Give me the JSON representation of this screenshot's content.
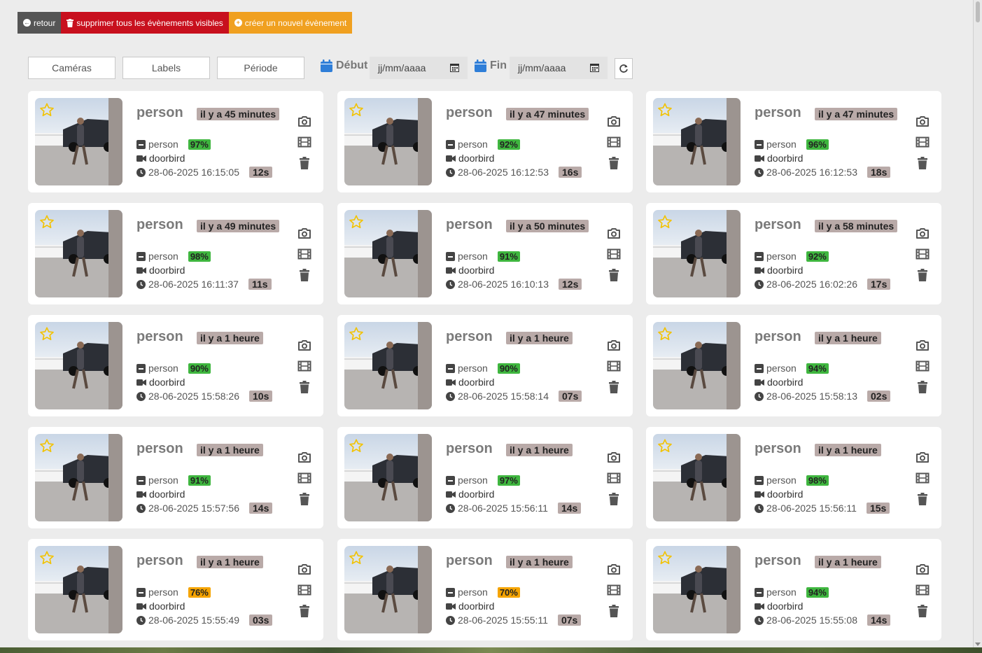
{
  "toolbar": {
    "back_label": "retour",
    "delete_all_label": "supprimer tous les évènements visibles",
    "new_event_label": "créer un nouvel évènement"
  },
  "filters": {
    "cameras_label": "Caméras",
    "labels_label": "Labels",
    "period_label": "Période",
    "start_label": "Début",
    "start_placeholder": "jj/mm/aaaa",
    "end_label": "Fin",
    "end_placeholder": "jj/mm/aaaa"
  },
  "colors": {
    "score_green": "#3fb63f",
    "score_orange": "#f5a400",
    "badge_bg": "#b9aaa8",
    "calendar_blue": "#2f7ed8"
  },
  "events": [
    {
      "label": "person",
      "ago": "il y a 45 minutes",
      "object": "person",
      "score": "97%",
      "score_level": "high",
      "camera": "doorbird",
      "datetime": "28-06-2025 16:15:05",
      "duration": "12s"
    },
    {
      "label": "person",
      "ago": "il y a 47 minutes",
      "object": "person",
      "score": "92%",
      "score_level": "high",
      "camera": "doorbird",
      "datetime": "28-06-2025 16:12:53",
      "duration": "16s"
    },
    {
      "label": "person",
      "ago": "il y a 47 minutes",
      "object": "person",
      "score": "96%",
      "score_level": "high",
      "camera": "doorbird",
      "datetime": "28-06-2025 16:12:53",
      "duration": "18s"
    },
    {
      "label": "person",
      "ago": "il y a 49 minutes",
      "object": "person",
      "score": "98%",
      "score_level": "high",
      "camera": "doorbird",
      "datetime": "28-06-2025 16:11:37",
      "duration": "11s"
    },
    {
      "label": "person",
      "ago": "il y a 50 minutes",
      "object": "person",
      "score": "91%",
      "score_level": "high",
      "camera": "doorbird",
      "datetime": "28-06-2025 16:10:13",
      "duration": "12s"
    },
    {
      "label": "person",
      "ago": "il y a 58 minutes",
      "object": "person",
      "score": "92%",
      "score_level": "high",
      "camera": "doorbird",
      "datetime": "28-06-2025 16:02:26",
      "duration": "17s"
    },
    {
      "label": "person",
      "ago": "il y a 1 heure",
      "object": "person",
      "score": "90%",
      "score_level": "high",
      "camera": "doorbird",
      "datetime": "28-06-2025 15:58:26",
      "duration": "10s"
    },
    {
      "label": "person",
      "ago": "il y a 1 heure",
      "object": "person",
      "score": "90%",
      "score_level": "high",
      "camera": "doorbird",
      "datetime": "28-06-2025 15:58:14",
      "duration": "07s"
    },
    {
      "label": "person",
      "ago": "il y a 1 heure",
      "object": "person",
      "score": "94%",
      "score_level": "high",
      "camera": "doorbird",
      "datetime": "28-06-2025 15:58:13",
      "duration": "02s"
    },
    {
      "label": "person",
      "ago": "il y a 1 heure",
      "object": "person",
      "score": "91%",
      "score_level": "high",
      "camera": "doorbird",
      "datetime": "28-06-2025 15:57:56",
      "duration": "14s"
    },
    {
      "label": "person",
      "ago": "il y a 1 heure",
      "object": "person",
      "score": "97%",
      "score_level": "high",
      "camera": "doorbird",
      "datetime": "28-06-2025 15:56:11",
      "duration": "14s"
    },
    {
      "label": "person",
      "ago": "il y a 1 heure",
      "object": "person",
      "score": "98%",
      "score_level": "high",
      "camera": "doorbird",
      "datetime": "28-06-2025 15:56:11",
      "duration": "15s"
    },
    {
      "label": "person",
      "ago": "il y a 1 heure",
      "object": "person",
      "score": "76%",
      "score_level": "medium",
      "camera": "doorbird",
      "datetime": "28-06-2025 15:55:49",
      "duration": "03s"
    },
    {
      "label": "person",
      "ago": "il y a 1 heure",
      "object": "person",
      "score": "70%",
      "score_level": "medium",
      "camera": "doorbird",
      "datetime": "28-06-2025 15:55:11",
      "duration": "07s"
    },
    {
      "label": "person",
      "ago": "il y a 1 heure",
      "object": "person",
      "score": "94%",
      "score_level": "high",
      "camera": "doorbird",
      "datetime": "28-06-2025 15:55:08",
      "duration": "14s"
    }
  ],
  "icons": {
    "back": "circle-arrow-left-icon",
    "delete_all": "trash-icon",
    "new_event": "plus-circle-icon",
    "calendar": "calendar-icon",
    "refresh": "refresh-icon",
    "favorite": "star-icon",
    "snapshot": "camera-icon",
    "clip": "film-icon",
    "delete": "trash-icon"
  }
}
